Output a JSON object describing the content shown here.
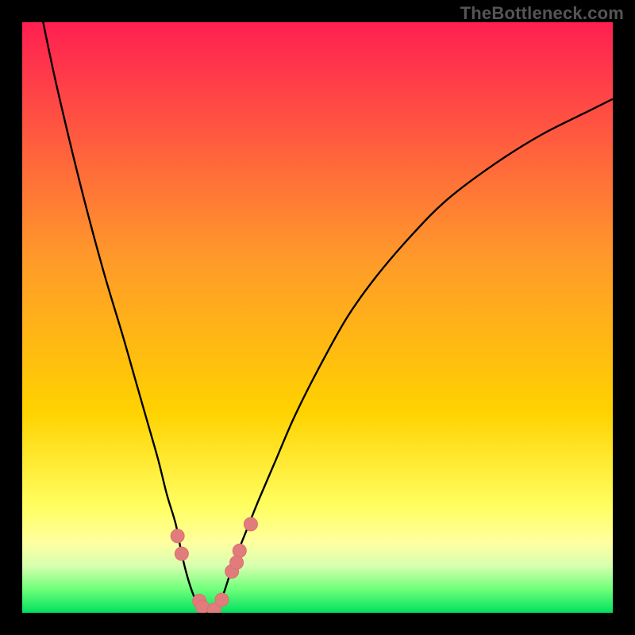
{
  "watermark": "TheBottleneck.com",
  "colors": {
    "bg_black": "#000000",
    "curve": "#000000",
    "dot_fill": "#e07c7c",
    "dot_stroke": "#de6f6f",
    "grad_top": "#ff1f50",
    "grad_mid": "#ffd200",
    "grad_low": "#ffff8a",
    "grad_pale": "#d8ffb0",
    "grad_green": "#00e060"
  },
  "chart_data": {
    "type": "line",
    "title": "",
    "xlabel": "",
    "ylabel": "",
    "xlim": [
      0,
      100
    ],
    "ylim": [
      0,
      100
    ],
    "series": [
      {
        "name": "bottleneck-curve",
        "x": [
          0,
          2,
          5,
          8,
          11,
          14,
          17,
          19,
          21,
          23,
          24.5,
          26,
          27,
          28,
          29,
          30,
          31,
          32,
          33,
          34,
          35,
          36,
          38,
          40,
          43,
          46,
          50,
          55,
          60,
          66,
          72,
          80,
          88,
          96,
          100
        ],
        "y": [
          120,
          108,
          93,
          80,
          68,
          57,
          47,
          40,
          33,
          26,
          20,
          15,
          10,
          6,
          3,
          1,
          0,
          0,
          1,
          3,
          6,
          9,
          14,
          19,
          26,
          33,
          41,
          50,
          57,
          64,
          70,
          76,
          81,
          85,
          87
        ]
      }
    ],
    "points": [
      {
        "x": 26.3,
        "y": 13
      },
      {
        "x": 27.0,
        "y": 10
      },
      {
        "x": 30.0,
        "y": 2
      },
      {
        "x": 30.5,
        "y": 1
      },
      {
        "x": 32.5,
        "y": 0.5
      },
      {
        "x": 33.8,
        "y": 2.2
      },
      {
        "x": 35.5,
        "y": 7
      },
      {
        "x": 36.8,
        "y": 10.5
      },
      {
        "x": 36.3,
        "y": 8.5
      },
      {
        "x": 38.7,
        "y": 15
      }
    ],
    "gradient_stops": [
      {
        "offset": 0,
        "color": "#ff1f50"
      },
      {
        "offset": 9,
        "color": "#ff3a4a"
      },
      {
        "offset": 40,
        "color": "#ff9a2a"
      },
      {
        "offset": 66,
        "color": "#ffd200"
      },
      {
        "offset": 82,
        "color": "#ffff60"
      },
      {
        "offset": 88,
        "color": "#ffff9f"
      },
      {
        "offset": 92,
        "color": "#d8ffb0"
      },
      {
        "offset": 96,
        "color": "#6fff7a"
      },
      {
        "offset": 100,
        "color": "#00e060"
      }
    ]
  }
}
